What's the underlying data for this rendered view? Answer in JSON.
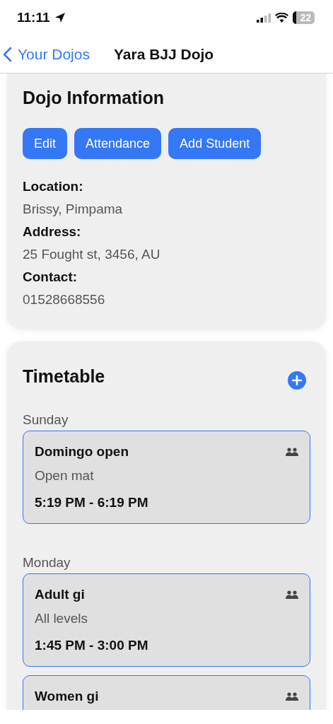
{
  "status_bar": {
    "time": "11:11",
    "battery": "22"
  },
  "nav": {
    "back": "Your Dojos",
    "title": "Yara BJJ Dojo"
  },
  "info": {
    "title": "Dojo Information",
    "buttons": [
      "Edit",
      "Attendance",
      "Add Student"
    ],
    "fields": [
      {
        "label": "Location:",
        "value": "Brissy, Pimpama"
      },
      {
        "label": "Address:",
        "value": "25 Fought st, 3456, AU"
      },
      {
        "label": "Contact:",
        "value": "01528668556"
      }
    ]
  },
  "timetable": {
    "title": "Timetable",
    "days": [
      {
        "day": "Sunday",
        "classes": [
          {
            "name": "Domingo open",
            "description": "Open mat",
            "time": "5:19 PM - 6:19 PM"
          }
        ]
      },
      {
        "day": "Monday",
        "classes": [
          {
            "name": "Adult gi",
            "description": "All levels",
            "time": "1:45 PM - 3:00 PM"
          },
          {
            "name": "Women gi"
          }
        ]
      }
    ]
  }
}
